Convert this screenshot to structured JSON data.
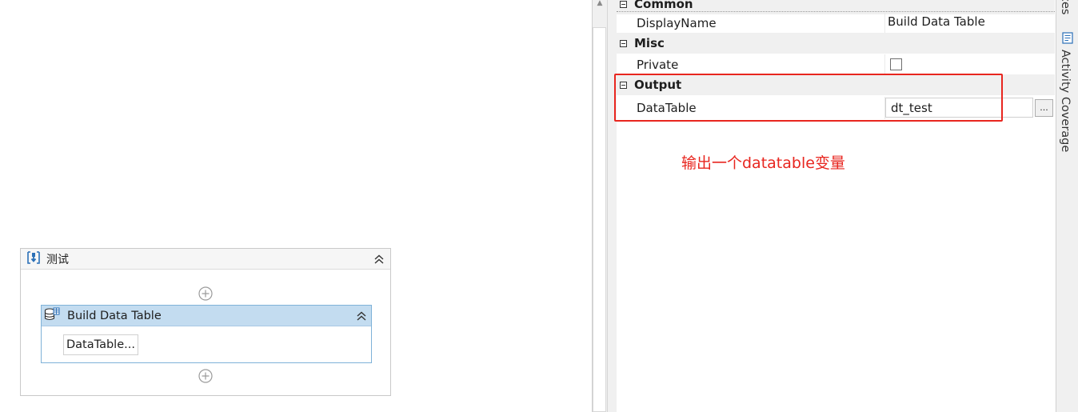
{
  "designer": {
    "sequence_title": "测试",
    "activity_title": "Build Data Table",
    "activity_button": "DataTable..."
  },
  "property_grid": {
    "categories": [
      {
        "name": "Common",
        "properties": [
          {
            "name": "DisplayName",
            "value": "Build Data Table"
          }
        ]
      },
      {
        "name": "Misc",
        "properties": [
          {
            "name": "Private",
            "checked": false
          }
        ]
      },
      {
        "name": "Output",
        "properties": [
          {
            "name": "DataTable",
            "value": "dt_test",
            "button": "..."
          }
        ]
      }
    ]
  },
  "annotation": "输出一个datatable变量",
  "side_tabs": {
    "tab_top": "ces",
    "tab_activity_coverage": "Activity Coverage"
  },
  "colors": {
    "highlight": "#e8261f",
    "activity_header": "#c3dcf0"
  }
}
